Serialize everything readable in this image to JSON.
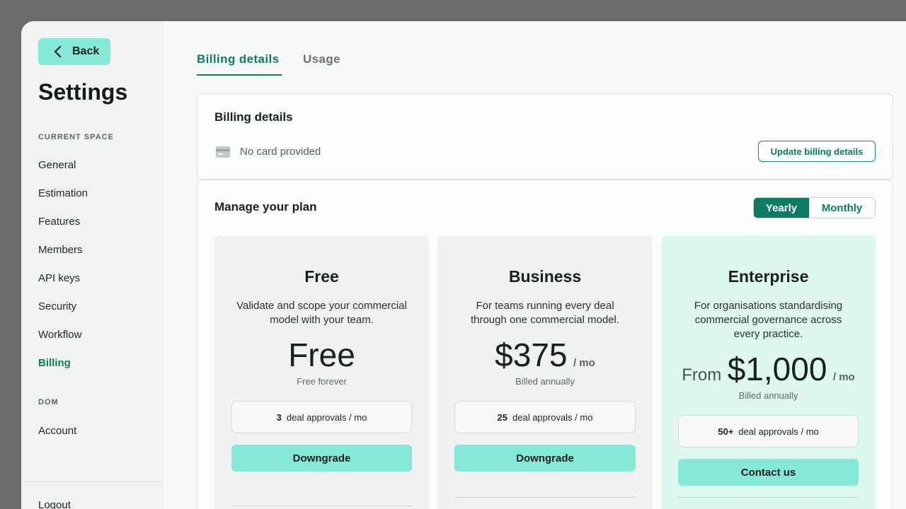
{
  "sidebar": {
    "back_label": "Back",
    "title": "Settings",
    "section_current": "CURRENT SPACE",
    "items": [
      "General",
      "Estimation",
      "Features",
      "Members",
      "API keys",
      "Security",
      "Workflow",
      "Billing"
    ],
    "active_item": "Billing",
    "section_dom": "DOM",
    "dom_items": [
      "Account"
    ],
    "logout_label": "Logout"
  },
  "tabs": [
    {
      "label": "Billing details",
      "active": true
    },
    {
      "label": "Usage",
      "active": false
    }
  ],
  "billing_card": {
    "title": "Billing details",
    "card_status": "No card provided",
    "card_icon": "credit-card-icon",
    "update_button": "Update billing details"
  },
  "plan_card": {
    "title": "Manage your plan",
    "toggle": {
      "yearly": "Yearly",
      "monthly": "Monthly",
      "selected": "Yearly"
    },
    "plans": [
      {
        "name": "Free",
        "description": "Validate and scope your commercial model with your team.",
        "price": "Free",
        "price_sub": "Free forever",
        "approvals_count": "3",
        "approvals_label": "deal approvals / mo",
        "button": "Downgrade"
      },
      {
        "name": "Business",
        "description": "For teams running every deal through one commercial model.",
        "price": "$375",
        "price_unit": "/ mo",
        "price_sub": "Billed annually",
        "approvals_count": "25",
        "approvals_label": "deal approvals / mo",
        "button": "Downgrade"
      },
      {
        "name": "Enterprise",
        "description": "For organisations standardising commercial governance across every practice.",
        "price_prefix": "From",
        "price": "$1,000",
        "price_unit": "/ mo",
        "price_sub": "Billed annually",
        "approvals_count": "50+",
        "approvals_label": "deal approvals / mo",
        "button": "Contact us"
      }
    ]
  },
  "colors": {
    "accent": "#0f7a62",
    "button_mint": "#86e8d6",
    "enterprise_bg": "#dff7f1"
  }
}
